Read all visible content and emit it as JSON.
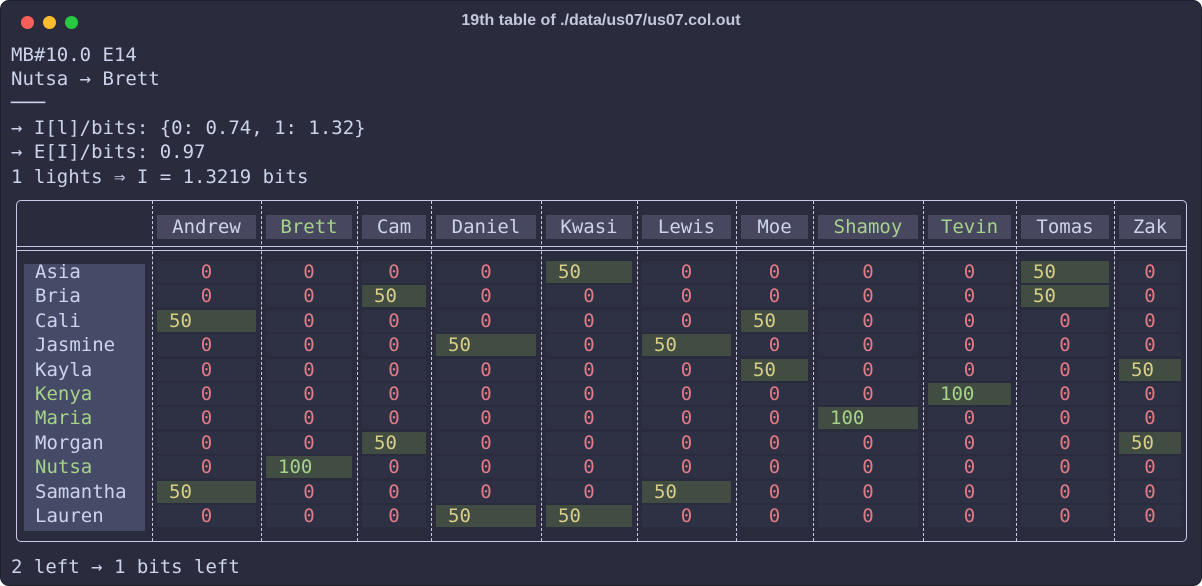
{
  "window": {
    "title": "19th table of ./data/us07/us07.col.out"
  },
  "header_lines": [
    "MB#10.0 E14",
    "Nutsa → Brett",
    "───",
    "→ I[l]/bits: {0: 0.74, 1: 1.32}",
    "→ E[I]/bits: 0.97",
    "1 lights ⇒ I = 1.3219 bits"
  ],
  "footer": "2 left → 1 bits left",
  "colors": {
    "background": "#2a2c3e",
    "text": "#cdd3ea",
    "zero": "#e07a86",
    "value": "#d8ce88",
    "highlight_name": "#a6d28a"
  },
  "table": {
    "columns": [
      "Andrew",
      "Brett",
      "Cam",
      "Daniel",
      "Kwasi",
      "Lewis",
      "Moe",
      "Shamoy",
      "Tevin",
      "Tomas",
      "Zak"
    ],
    "highlighted_columns": [
      "Brett",
      "Shamoy",
      "Tevin"
    ],
    "rows": [
      {
        "name": "Asia",
        "highlight": false,
        "values": [
          "0",
          "0",
          "0",
          "0",
          "50",
          "0",
          "0",
          "0",
          "0",
          "50",
          "0"
        ]
      },
      {
        "name": "Bria",
        "highlight": false,
        "values": [
          "0",
          "0",
          "50",
          "0",
          "0",
          "0",
          "0",
          "0",
          "0",
          "50",
          "0"
        ]
      },
      {
        "name": "Cali",
        "highlight": false,
        "values": [
          "50",
          "0",
          "0",
          "0",
          "0",
          "0",
          "50",
          "0",
          "0",
          "0",
          "0"
        ]
      },
      {
        "name": "Jasmine",
        "highlight": false,
        "values": [
          "0",
          "0",
          "0",
          "50",
          "0",
          "50",
          "0",
          "0",
          "0",
          "0",
          "0"
        ]
      },
      {
        "name": "Kayla",
        "highlight": false,
        "values": [
          "0",
          "0",
          "0",
          "0",
          "0",
          "0",
          "50",
          "0",
          "0",
          "0",
          "50"
        ]
      },
      {
        "name": "Kenya",
        "highlight": true,
        "values": [
          "0",
          "0",
          "0",
          "0",
          "0",
          "0",
          "0",
          "0",
          "100",
          "0",
          "0"
        ]
      },
      {
        "name": "Maria",
        "highlight": true,
        "values": [
          "0",
          "0",
          "0",
          "0",
          "0",
          "0",
          "0",
          "100",
          "0",
          "0",
          "0"
        ]
      },
      {
        "name": "Morgan",
        "highlight": false,
        "values": [
          "0",
          "0",
          "50",
          "0",
          "0",
          "0",
          "0",
          "0",
          "0",
          "0",
          "50"
        ]
      },
      {
        "name": "Nutsa",
        "highlight": true,
        "values": [
          "0",
          "100",
          "0",
          "0",
          "0",
          "0",
          "0",
          "0",
          "0",
          "0",
          "0"
        ]
      },
      {
        "name": "Samantha",
        "highlight": false,
        "values": [
          "50",
          "0",
          "0",
          "0",
          "0",
          "50",
          "0",
          "0",
          "0",
          "0",
          "0"
        ]
      },
      {
        "name": "Lauren",
        "highlight": false,
        "values": [
          "0",
          "0",
          "0",
          "50",
          "50",
          "0",
          "0",
          "0",
          "0",
          "0",
          "0"
        ]
      }
    ]
  }
}
